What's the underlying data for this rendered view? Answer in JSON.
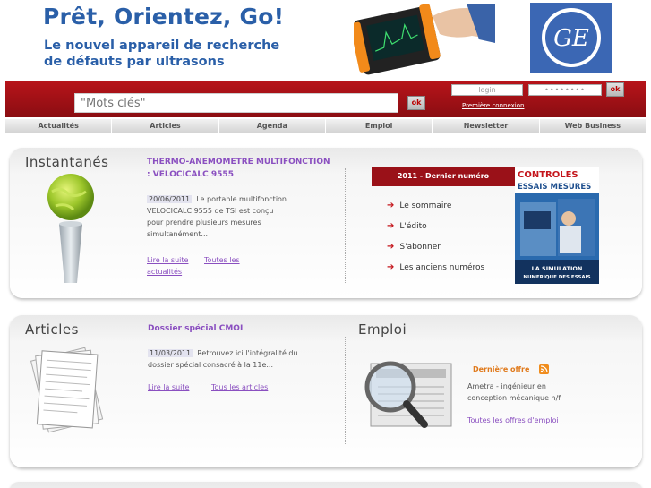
{
  "banner": {
    "headline": "Prêt, Orientez, Go!",
    "subline1": "Le nouvel appareil de recherche",
    "subline2": "de défauts par ultrasons",
    "logo_text": "GE"
  },
  "search": {
    "placeholder": "\"Mots clés\"",
    "ok_label": "ok"
  },
  "login": {
    "user_placeholder": "login",
    "pass_placeholder": "••••••••",
    "ok_label": "ok",
    "first_connection": "Première connexion"
  },
  "nav": [
    "Actualités",
    "Articles",
    "Agenda",
    "Emploi",
    "Newsletter",
    "Web Business"
  ],
  "instantanes": {
    "heading": "Instantanés",
    "title_line1": "THERMO-ANEMOMETRE MULTIFONCTION",
    "title_line2": ": VELOCICALC 9555",
    "date": "20/06/2011",
    "text_line1": "Le portable multifonction",
    "text_line2": "VELOCICALC 9555 de TSI est conçu",
    "text_line3": "pour prendre plusieurs mesures",
    "text_line4": "simultanément...",
    "read_more": "Lire la suite",
    "all_news_line1": "Toutes les",
    "all_news_line2": "actualités"
  },
  "magazine": {
    "heading": "2011 - Dernier numéro",
    "items": [
      "Le sommaire",
      "L'édito",
      "S'abonner",
      "Les anciens numéros"
    ],
    "cover_title1": "CONTROLES",
    "cover_title2": "ESSAIS MESURES",
    "cover_caption1": "LA SIMULATION",
    "cover_caption2": "NUMERIQUE DES ESSAIS"
  },
  "articles": {
    "heading": "Articles",
    "title": "Dossier spécial CMOI",
    "date": "11/03/2011",
    "text_line1": "Retrouvez ici l'intégralité du",
    "text_line2": "dossier spécial consacré à la 11e...",
    "read_more": "Lire la suite",
    "all_articles": "Tous les articles"
  },
  "emploi": {
    "heading": "Emploi",
    "latest_label": "Dernière offre",
    "offer_line1": "Ametra - ingénieur en",
    "offer_line2": "conception mécanique h/f",
    "all_offers": "Toutes les offres d'emploi"
  },
  "colors": {
    "brand_red": "#b8141a",
    "link_purple": "#8a4fc0",
    "banner_blue": "#2a5fa8",
    "accent_orange": "#e07a1c"
  }
}
